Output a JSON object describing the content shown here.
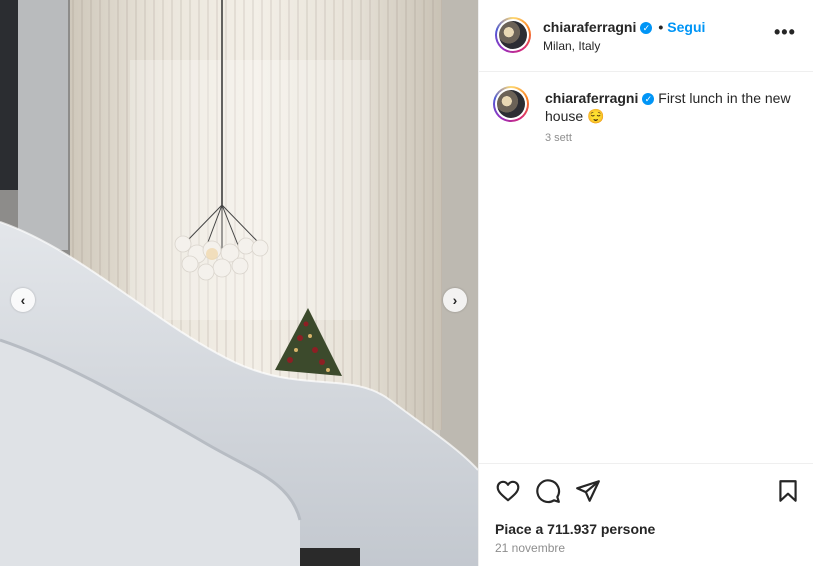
{
  "post": {
    "username": "chiaraferragni",
    "verified_mark": "✓",
    "separator": "•",
    "follow_label": "Segui",
    "location": "Milan, Italy",
    "more_label": "•••",
    "caption": "First lunch in the new house",
    "caption_emoji": "😌",
    "time_ago": "3 sett",
    "likes": "Piace a 711.937 persone",
    "date": "21 novembre"
  },
  "carousel": {
    "prev_label": "‹",
    "next_label": "›"
  },
  "icons": {
    "like": "heart-icon",
    "comment": "comment-icon",
    "share": "paper-plane-icon",
    "save": "bookmark-icon"
  },
  "colors": {
    "accent": "#0095f6",
    "text": "#262626",
    "secondary": "#8e8e8e",
    "border": "#efefef"
  }
}
